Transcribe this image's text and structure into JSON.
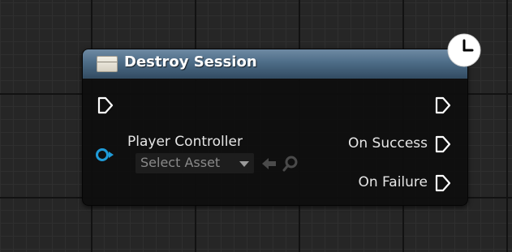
{
  "node": {
    "title": "Destroy Session",
    "header_color": "#4d6c87",
    "icon": "function-icon",
    "latent_icon": "clock-icon"
  },
  "pins": {
    "exec_in": {
      "icon": "exec-pin-icon"
    },
    "exec_out": {
      "icon": "exec-pin-icon"
    },
    "player_controller": {
      "label": "Player Controller",
      "color": "#1f9bd8",
      "asset_picker": "Select Asset",
      "icons": [
        "use-selected-arrow-icon",
        "browse-search-icon"
      ]
    },
    "on_success": {
      "label": "On Success"
    },
    "on_failure": {
      "label": "On Failure"
    }
  }
}
